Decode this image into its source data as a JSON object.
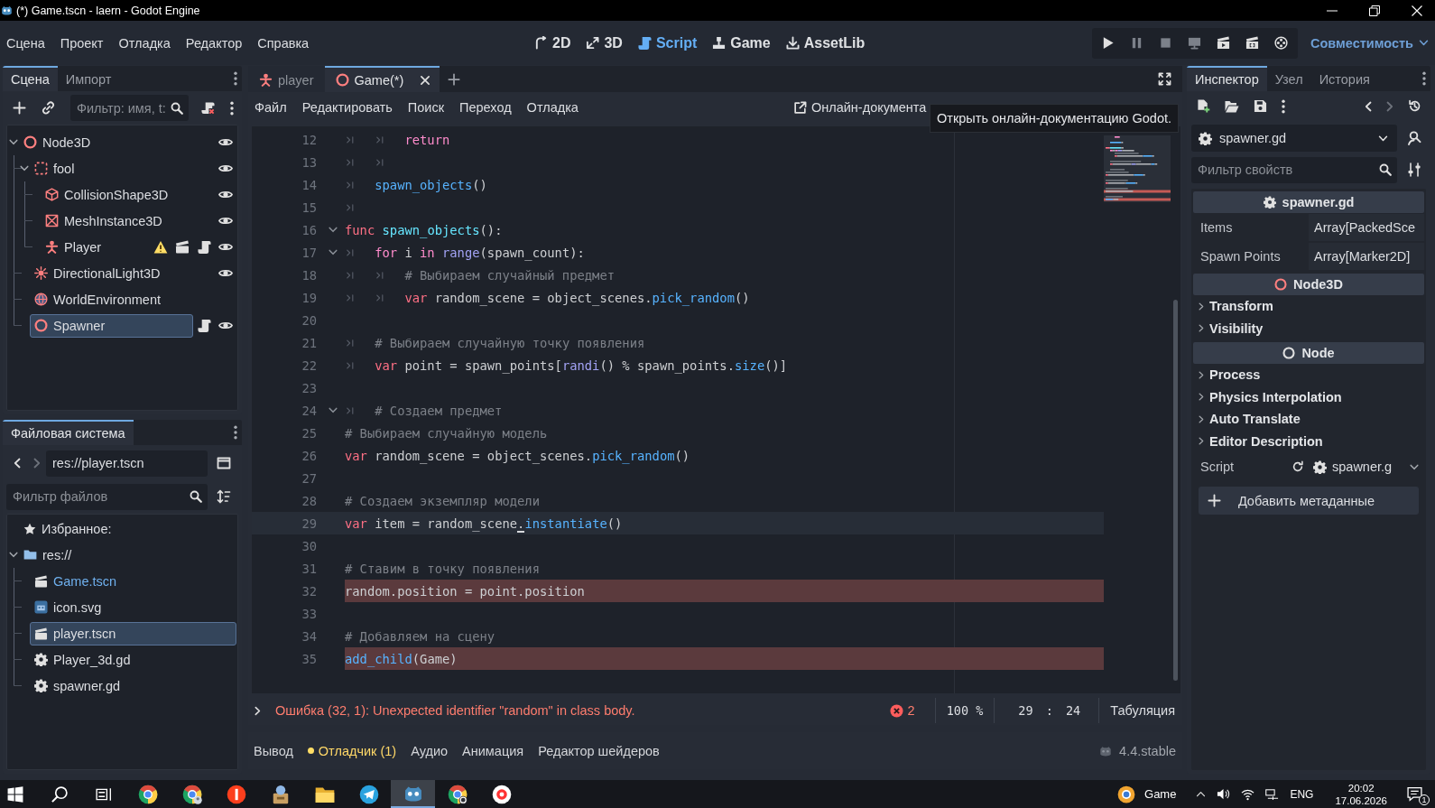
{
  "window": {
    "title": "(*) Game.tscn - laern - Godot Engine"
  },
  "menu": [
    "Сцена",
    "Проект",
    "Отладка",
    "Редактор",
    "Справка"
  ],
  "workspaces": [
    {
      "label": "2D",
      "kind": "planar",
      "selected": false
    },
    {
      "label": "3D",
      "kind": "spatial",
      "selected": false
    },
    {
      "label": "Script",
      "kind": "script",
      "selected": true
    },
    {
      "label": "Game",
      "kind": "game",
      "selected": false
    },
    {
      "label": "AssetLib",
      "kind": "assetlib",
      "selected": false
    }
  ],
  "run_buttons": [
    {
      "kind": "play",
      "disabled": false
    },
    {
      "kind": "pause",
      "disabled": true
    },
    {
      "kind": "stop",
      "disabled": true
    },
    {
      "kind": "remote",
      "disabled": true
    },
    {
      "kind": "scene",
      "disabled": false
    },
    {
      "kind": "custom",
      "disabled": false
    },
    {
      "kind": "movie",
      "disabled": false
    }
  ],
  "renderer": {
    "label": "Совместимость"
  },
  "scene_dock": {
    "tabs": [
      {
        "label": "Сцена",
        "selected": true
      },
      {
        "label": "Импорт",
        "selected": false
      }
    ],
    "filter": {
      "placeholder": "Фильтр: имя, t:"
    },
    "tree": [
      {
        "name": "Node3D",
        "kind": "node3d",
        "selected": false,
        "expanded": true,
        "indicators": [
          {
            "kind": "visible"
          }
        ],
        "children": [
          {
            "name": "fool",
            "kind": "area",
            "selected": false,
            "expanded": true,
            "indicators": [
              {
                "kind": "visible"
              }
            ],
            "children": [
              {
                "name": "CollisionShape3D",
                "kind": "collision",
                "selected": false,
                "indicators": [
                  {
                    "kind": "visible"
                  }
                ]
              },
              {
                "name": "MeshInstance3D",
                "kind": "mesh",
                "selected": false,
                "indicators": [
                  {
                    "kind": "visible"
                  }
                ]
              },
              {
                "name": "Player",
                "kind": "instance",
                "selected": false,
                "indicators": [
                  {
                    "kind": "warning"
                  },
                  {
                    "kind": "openscene"
                  },
                  {
                    "kind": "script"
                  },
                  {
                    "kind": "visible"
                  }
                ]
              }
            ]
          },
          {
            "name": "DirectionalLight3D",
            "kind": "light",
            "selected": false,
            "indicators": [
              {
                "kind": "visible"
              }
            ]
          },
          {
            "name": "WorldEnvironment",
            "kind": "environment",
            "selected": false
          },
          {
            "name": "Spawner",
            "kind": "node3d",
            "selected": true,
            "indicators": [
              {
                "kind": "script"
              },
              {
                "kind": "visible"
              }
            ]
          }
        ]
      }
    ]
  },
  "filesystem": {
    "tabs": [
      {
        "label": "Файловая система",
        "selected": true
      }
    ],
    "path": "res://player.tscn",
    "filter": {
      "placeholder": "Фильтр файлов"
    },
    "favorites": "Избранное:",
    "tree": [
      {
        "name": "res://",
        "kind": "folder",
        "selected": false,
        "current": false,
        "expanded": true,
        "children": [
          {
            "name": "Game.tscn",
            "kind": "scene",
            "selected": false,
            "current": true
          },
          {
            "name": "icon.svg",
            "kind": "image",
            "selected": false,
            "current": false
          },
          {
            "name": "player.tscn",
            "kind": "scene",
            "selected": true,
            "current": false
          },
          {
            "name": "Player_3d.gd",
            "kind": "script",
            "selected": false,
            "current": false
          },
          {
            "name": "spawner.gd",
            "kind": "script",
            "selected": false,
            "current": false
          }
        ]
      }
    ]
  },
  "editor": {
    "tabs": [
      {
        "label": "player",
        "kind": "instance",
        "selected": false
      },
      {
        "label": "Game(*)",
        "kind": "node3d",
        "selected": true
      }
    ],
    "menu": [
      "Файл",
      "Редактировать",
      "Поиск",
      "Переход",
      "Отладка"
    ],
    "docs_button": "Онлайн-документа",
    "tooltip": "Открыть онлайн-документацию Godot.",
    "lines": [
      {
        "number": "12",
        "kind": "plain",
        "fold": false,
        "tokens": [
          {
            "kind": "tab"
          },
          {
            "kind": "tab"
          },
          {
            "kind": "control",
            "text": "return"
          }
        ]
      },
      {
        "number": "13",
        "kind": "plain",
        "fold": false,
        "tokens": [
          {
            "kind": "tab"
          },
          {
            "kind": "tab"
          }
        ]
      },
      {
        "number": "14",
        "kind": "plain",
        "fold": false,
        "tokens": [
          {
            "kind": "tab"
          },
          {
            "kind": "call",
            "text": "spawn_objects"
          },
          {
            "kind": "text",
            "text": "()"
          }
        ]
      },
      {
        "number": "15",
        "kind": "plain",
        "fold": false,
        "tokens": [
          {
            "kind": "tab"
          }
        ]
      },
      {
        "number": "16",
        "kind": "plain",
        "fold": true,
        "tokens": [
          {
            "kind": "keyword",
            "text": "func "
          },
          {
            "kind": "funcdef",
            "text": "spawn_objects"
          },
          {
            "kind": "text",
            "text": "():"
          }
        ]
      },
      {
        "number": "17",
        "kind": "plain",
        "fold": true,
        "tokens": [
          {
            "kind": "tab"
          },
          {
            "kind": "control",
            "text": "for"
          },
          {
            "kind": "text",
            "text": " i "
          },
          {
            "kind": "control",
            "text": "in "
          },
          {
            "kind": "builtin",
            "text": "range"
          },
          {
            "kind": "text",
            "text": "(spawn_count):"
          }
        ]
      },
      {
        "number": "18",
        "kind": "plain",
        "fold": false,
        "tokens": [
          {
            "kind": "tab"
          },
          {
            "kind": "tab"
          },
          {
            "kind": "comment",
            "text": "# Выбираем случайный предмет"
          }
        ]
      },
      {
        "number": "19",
        "kind": "plain",
        "fold": false,
        "tokens": [
          {
            "kind": "tab"
          },
          {
            "kind": "tab"
          },
          {
            "kind": "keyword",
            "text": "var"
          },
          {
            "kind": "text",
            "text": " random_scene = object_scenes."
          },
          {
            "kind": "call",
            "text": "pick_random"
          },
          {
            "kind": "text",
            "text": "()"
          }
        ]
      },
      {
        "number": "20",
        "kind": "plain",
        "fold": false
      },
      {
        "number": "21",
        "kind": "plain",
        "fold": false,
        "tokens": [
          {
            "kind": "tab"
          },
          {
            "kind": "comment",
            "text": "# Выбираем случайную точку появления"
          }
        ]
      },
      {
        "number": "22",
        "kind": "plain",
        "fold": false,
        "tokens": [
          {
            "kind": "tab"
          },
          {
            "kind": "keyword",
            "text": "var"
          },
          {
            "kind": "text",
            "text": " point = spawn_points["
          },
          {
            "kind": "builtin",
            "text": "randi"
          },
          {
            "kind": "text",
            "text": "() % spawn_points."
          },
          {
            "kind": "call",
            "text": "size"
          },
          {
            "kind": "text",
            "text": "()]"
          }
        ]
      },
      {
        "number": "23",
        "kind": "plain",
        "fold": false
      },
      {
        "number": "24",
        "kind": "plain",
        "fold": true,
        "tokens": [
          {
            "kind": "tab"
          },
          {
            "kind": "comment",
            "text": "# Создаем предмет"
          }
        ]
      },
      {
        "number": "25",
        "kind": "plain",
        "fold": false,
        "tokens": [
          {
            "kind": "comment",
            "text": "# Выбираем случайную модель"
          }
        ]
      },
      {
        "number": "26",
        "kind": "plain",
        "fold": false,
        "tokens": [
          {
            "kind": "keyword",
            "text": "var"
          },
          {
            "kind": "text",
            "text": " random_scene = object_scenes."
          },
          {
            "kind": "call",
            "text": "pick_random"
          },
          {
            "kind": "text",
            "text": "()"
          }
        ]
      },
      {
        "number": "27",
        "kind": "plain",
        "fold": false
      },
      {
        "number": "28",
        "kind": "plain",
        "fold": false,
        "tokens": [
          {
            "kind": "comment",
            "text": "# Создаем экземпляр модели"
          }
        ]
      },
      {
        "number": "29",
        "kind": "current",
        "fold": false,
        "tokens": [
          {
            "kind": "keyword",
            "text": "var"
          },
          {
            "kind": "text",
            "text": " item = random_scene"
          },
          {
            "kind": "caret",
            "text": "."
          },
          {
            "kind": "call",
            "text": "instantiate"
          },
          {
            "kind": "text",
            "text": "()"
          }
        ]
      },
      {
        "number": "30",
        "kind": "plain",
        "fold": false
      },
      {
        "number": "31",
        "kind": "plain",
        "fold": false,
        "tokens": [
          {
            "kind": "comment",
            "text": "# Ставим в точку появления"
          }
        ]
      },
      {
        "number": "32",
        "kind": "error",
        "fold": false,
        "tokens": [
          {
            "kind": "text",
            "text": "random.position = point.position"
          }
        ]
      },
      {
        "number": "33",
        "kind": "plain",
        "fold": false
      },
      {
        "number": "34",
        "kind": "plain",
        "fold": false,
        "tokens": [
          {
            "kind": "comment",
            "text": "# Добавляем на сцену"
          }
        ]
      },
      {
        "number": "35",
        "kind": "error",
        "fold": false,
        "tokens": [
          {
            "kind": "call",
            "text": "add_child"
          },
          {
            "kind": "text",
            "text": "(Game)"
          }
        ]
      }
    ],
    "status": {
      "message": "Ошибка (32, 1): Unexpected identifier \"random\" in class body.",
      "errors": "2",
      "zoom": "100 %",
      "position": "29 : 24",
      "indentation": "Табуляция"
    }
  },
  "bottom_panel": {
    "tabs": [
      {
        "label": "Вывод",
        "selected": false,
        "alert": false
      },
      {
        "label": "Отладчик (1)",
        "selected": false,
        "alert": true
      },
      {
        "label": "Аудио",
        "selected": false,
        "alert": false
      },
      {
        "label": "Анимация",
        "selected": false,
        "alert": false
      },
      {
        "label": "Редактор шейдеров",
        "selected": false,
        "alert": false
      }
    ],
    "version": "4.4.stable"
  },
  "inspector": {
    "tabs": [
      {
        "label": "Инспектор",
        "selected": true
      },
      {
        "label": "Узел",
        "selected": false
      },
      {
        "label": "История",
        "selected": false
      }
    ],
    "object": {
      "name": "spawner.gd",
      "kind": "script"
    },
    "filter": {
      "placeholder": "Фильтр свойств"
    },
    "rows": [
      {
        "kind": "scriptheader",
        "title": "spawner.gd"
      },
      {
        "kind": "property",
        "label": "Items",
        "value": "Array[PackedSce"
      },
      {
        "kind": "property",
        "label": "Spawn Points",
        "value": "Array[Marker2D]"
      },
      {
        "kind": "node3dheader",
        "title": "Node3D"
      },
      {
        "kind": "group",
        "label": "Transform",
        "expanded": false
      },
      {
        "kind": "group",
        "label": "Visibility",
        "expanded": false
      },
      {
        "kind": "nodeheader",
        "title": "Node"
      },
      {
        "kind": "group",
        "label": "Process",
        "expanded": false
      },
      {
        "kind": "group",
        "label": "Physics Interpolation",
        "expanded": false
      },
      {
        "kind": "group",
        "label": "Auto Translate",
        "expanded": false
      },
      {
        "kind": "group",
        "label": "Editor Description",
        "expanded": false
      },
      {
        "kind": "resource",
        "label": "Script",
        "value": "spawner.g"
      },
      {
        "kind": "button",
        "label": "Добавить метаданные"
      }
    ]
  },
  "taskbar": {
    "apps": [
      {
        "kind": "start",
        "selected": false
      },
      {
        "kind": "search",
        "selected": false
      },
      {
        "kind": "taskview",
        "selected": false
      },
      {
        "kind": "chrome",
        "selected": false
      },
      {
        "kind": "chromeprofile",
        "selected": false
      },
      {
        "kind": "yandex",
        "selected": false
      },
      {
        "kind": "archiver",
        "selected": false
      },
      {
        "kind": "explorer",
        "selected": false
      },
      {
        "kind": "telegram",
        "selected": false
      },
      {
        "kind": "godot",
        "selected": true
      },
      {
        "kind": "chromeuser",
        "selected": false
      },
      {
        "kind": "yandexbrowser",
        "selected": false
      }
    ],
    "tray": {
      "app": "Game",
      "language": "ENG",
      "time": "20:02",
      "date": "17.06.2026",
      "notifications": "1"
    }
  }
}
